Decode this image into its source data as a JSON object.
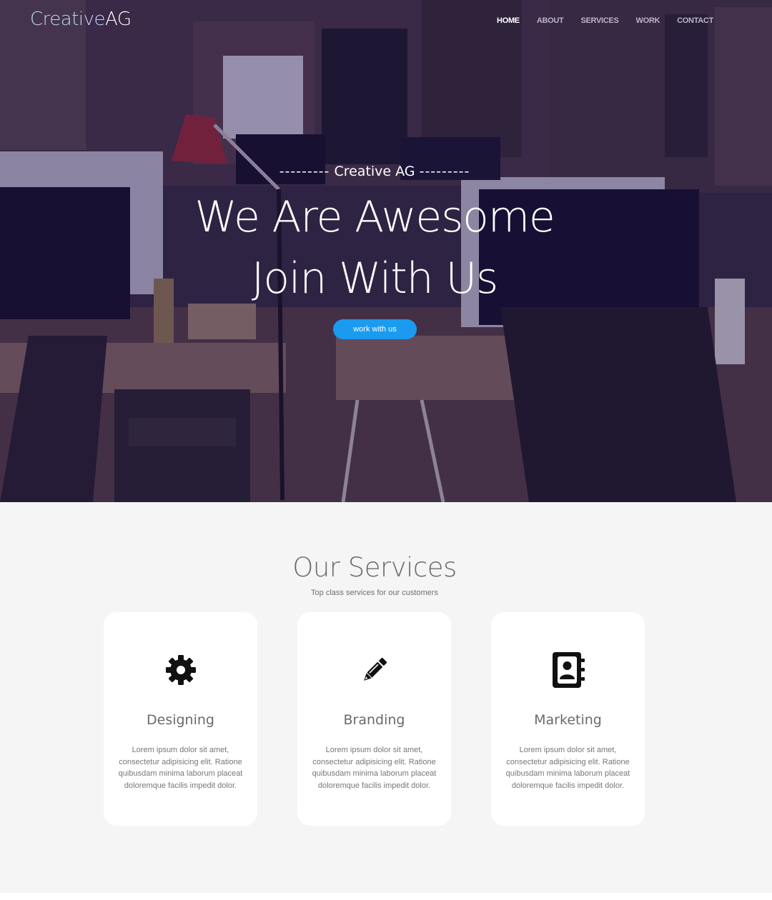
{
  "brand": {
    "logo_part1": "Creative",
    "logo_part2": "AG"
  },
  "nav": {
    "items": [
      {
        "label": "HOME",
        "active": true
      },
      {
        "label": "ABOUT",
        "active": false
      },
      {
        "label": "SERVICES",
        "active": false
      },
      {
        "label": "WORK",
        "active": false
      },
      {
        "label": "CONTACT",
        "active": false
      }
    ]
  },
  "hero": {
    "kicker_dashes_left": "---------",
    "kicker": "Creative AG",
    "kicker_dashes_right": "---------",
    "title_line1": "We Are Awesome",
    "title_line2": "Join With Us",
    "cta_label": "work with us",
    "cta_color": "#1a9bf0"
  },
  "services": {
    "title": "Our Services",
    "subtitle": "Top class services for our customers",
    "cards": [
      {
        "icon": "gear-icon",
        "title": "Designing",
        "text": "Lorem ipsum dolor sit amet, consectetur adipisicing elit. Ratione quibusdam minima laborum placeat doloremque facilis impedit dolor."
      },
      {
        "icon": "pencil-icon",
        "title": "Branding",
        "text": "Lorem ipsum dolor sit amet, consectetur adipisicing elit. Ratione quibusdam minima laborum placeat doloremque facilis impedit dolor."
      },
      {
        "icon": "contact-book-icon",
        "title": "Marketing",
        "text": "Lorem ipsum dolor sit amet, consectetur adipisicing elit. Ratione quibusdam minima laborum placeat doloremque facilis impedit dolor."
      }
    ]
  }
}
